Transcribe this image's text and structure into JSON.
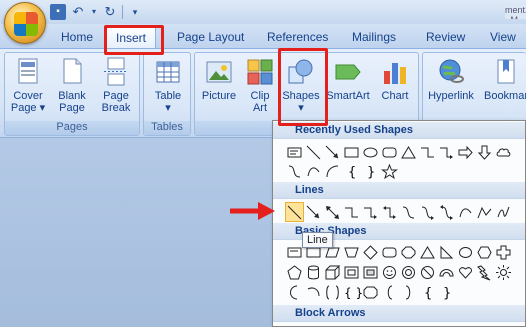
{
  "qat": {
    "icons": [
      "save-icon",
      "undo-icon",
      "redo-icon",
      "customize-icon"
    ]
  },
  "title_fragment": "ment1 - M",
  "tabs": [
    "Home",
    "Insert",
    "Page Layout",
    "References",
    "Mailings",
    "Review",
    "View"
  ],
  "active_tab": "Insert",
  "ribbon": {
    "pages": {
      "label": "Pages",
      "buttons": [
        "Cover\nPage ▾",
        "Blank\nPage",
        "Page\nBreak"
      ]
    },
    "tables": {
      "label": "Tables",
      "buttons": [
        "Table\n▾"
      ]
    },
    "illustrations": {
      "label": "Il",
      "buttons": [
        "Picture",
        "Clip\nArt",
        "Shapes\n▾",
        "SmartArt",
        "Chart"
      ]
    },
    "links": {
      "buttons": [
        "Hyperlink",
        "Bookmark"
      ]
    }
  },
  "menu": {
    "recent_label": "Recently Used Shapes",
    "lines_label": "Lines",
    "basic_label": "Basic Shapes",
    "block_label": "Block Arrows"
  },
  "tooltip": "Line",
  "colors": {
    "accent": "#e3201b",
    "highlight": "#ffe398"
  }
}
